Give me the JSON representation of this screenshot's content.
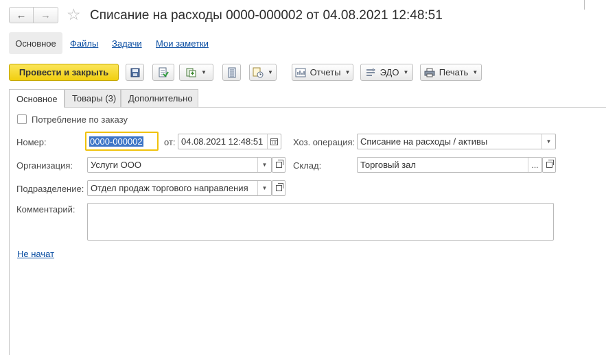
{
  "header": {
    "title": "Списание на расходы 0000-000002 от 04.08.2021 12:48:51",
    "back_icon": "←",
    "forward_icon": "→",
    "star_icon": "☆"
  },
  "sections": {
    "active": "Основное",
    "links": [
      "Файлы",
      "Задачи",
      "Мои заметки"
    ]
  },
  "toolbar": {
    "post_and_close": "Провести и закрыть",
    "reports": "Отчеты",
    "edo": "ЭДО",
    "print": "Печать"
  },
  "tabs": [
    "Основное",
    "Товары (3)",
    "Дополнительно"
  ],
  "form": {
    "consumption_by_order": "Потребление по заказу",
    "number_label": "Номер:",
    "number_value": "0000-000002",
    "date_label": "от:",
    "date_value": "04.08.2021 12:48:51",
    "operation_label": "Хоз. операция:",
    "operation_value": "Списание на расходы / активы",
    "organization_label": "Организация:",
    "organization_value": "Услуги ООО",
    "warehouse_label": "Склад:",
    "warehouse_value": "Торговый зал",
    "department_label": "Подразделение:",
    "department_value": "Отдел продаж торгового направления",
    "comment_label": "Комментарий:",
    "comment_value": "",
    "status_link": "Не начат"
  },
  "colors": {
    "primary_button": "#f1cf10",
    "link": "#0b4ea2",
    "focus_border": "#f0c20b",
    "selection": "#3d75c7"
  }
}
